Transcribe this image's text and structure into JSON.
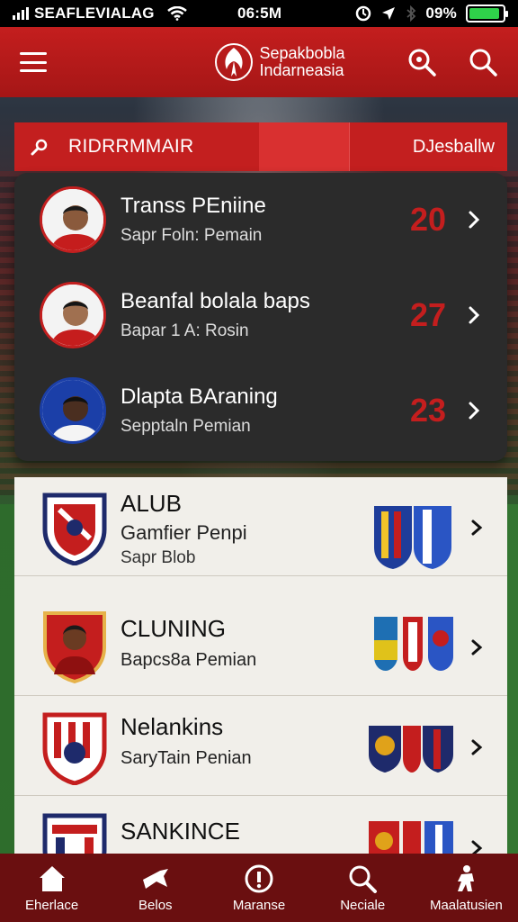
{
  "status_bar": {
    "carrier": "SEAFLEVIALAG",
    "time": "06:5M",
    "battery": "09%"
  },
  "app_bar": {
    "title_line1": "Sepakbobla",
    "title_line2": "Indarneasia",
    "menu_icon": "hamburger-icon",
    "action_icons": [
      "search-icon",
      "search-icon"
    ]
  },
  "filter_bar": {
    "search_label": "RIDRRMMAIR",
    "right_label": "DJesballw"
  },
  "players": [
    {
      "name": "Transs PEniine",
      "sub": "Sapr Foln: Pemain",
      "number": "20"
    },
    {
      "name": "Beanfal bolala baps",
      "sub": "Bapar 1 A: Rosin",
      "number": "27"
    },
    {
      "name": "Dlapta BAraning",
      "sub": "Sepptaln Pemian",
      "number": "23"
    }
  ],
  "clubs": [
    {
      "title": "ALUB",
      "line": "Gamfier Penpi",
      "sub": "Sapr Blob"
    },
    {
      "title": "CLUNING",
      "line": "Bapcs8a Pemian",
      "sub": ""
    },
    {
      "title": "Nelankins",
      "line": "SaryTain Penian",
      "sub": ""
    },
    {
      "title": "SANKINCE",
      "line": "",
      "sub": ""
    }
  ],
  "bottom_nav": [
    {
      "label": "Eherlace",
      "icon": "home-icon"
    },
    {
      "label": "Belos",
      "icon": "whistle-icon"
    },
    {
      "label": "Maranse",
      "icon": "info-icon"
    },
    {
      "label": "Neciale",
      "icon": "search-icon"
    },
    {
      "label": "Maalatusien",
      "icon": "player-icon"
    }
  ],
  "colors": {
    "brand_red": "#c41e1e",
    "dark_card": "#2b2b2b",
    "list_bg": "#f1efea",
    "nav_bg": "#6a0f10",
    "battery_green": "#2fd24a"
  }
}
